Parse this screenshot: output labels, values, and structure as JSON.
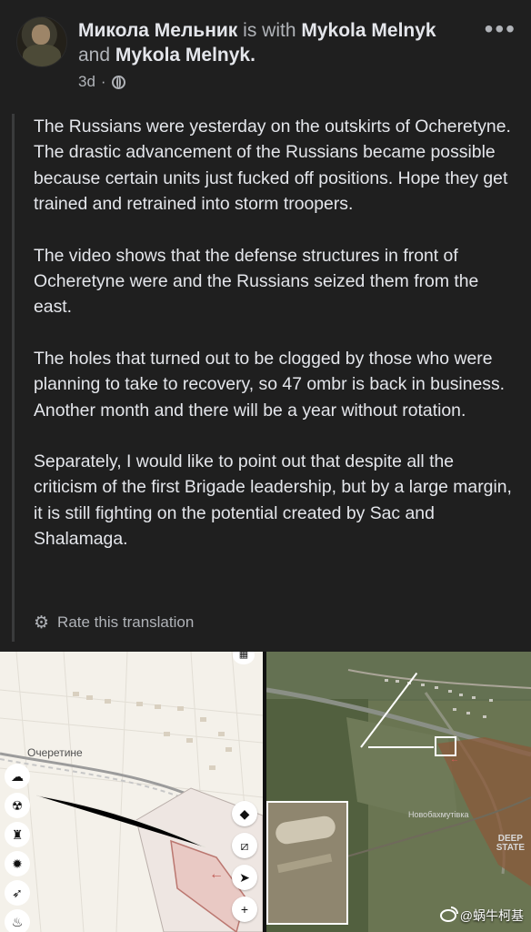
{
  "post": {
    "author": "Микола Мельник",
    "with_text": "is with",
    "tagged_1": "Mykola Melnyk",
    "and_text": "and",
    "tagged_2": "Mykola Melnyk.",
    "time": "3d",
    "separator": "·",
    "privacy_icon": "globe-icon",
    "more_icon": "more-options-icon"
  },
  "content": {
    "paragraphs": [
      "The Russians were yesterday on the outskirts of Ocheretyne. The drastic advancement of the Russians became possible because certain units just fucked off positions. Hope they get trained and retrained into storm troopers.",
      "The video shows that the defense structures in front of Ocheretyne were and the Russians seized them from the east.",
      "The holes that turned out to be clogged by those who were planning to take to recovery, so 47 ombr is back in business. Another month and there will be a year without rotation.",
      "Separately, I would like to point out that despite all the criticism of the first Brigade leadership, but by a large margin, it is still fighting on the potential created by Sac and Shalamaga."
    ],
    "rate_translation": "Rate this translation",
    "rate_icon": "gear-icon"
  },
  "images": {
    "map_label": "Очеретине",
    "deepstate_label": "DEEP\nSTATE",
    "settlement_label": "Новобахмутівка",
    "watermark": "@蜗牛柯基",
    "tools_left_icons": [
      "weather-icon",
      "radiation-icon",
      "fortress-icon",
      "explosion-icon",
      "rocket-icon",
      "fire-icon"
    ],
    "tools_right_icons": [
      "layers-icon",
      "ruler-icon",
      "locate-icon",
      "zoom-in-icon"
    ]
  }
}
